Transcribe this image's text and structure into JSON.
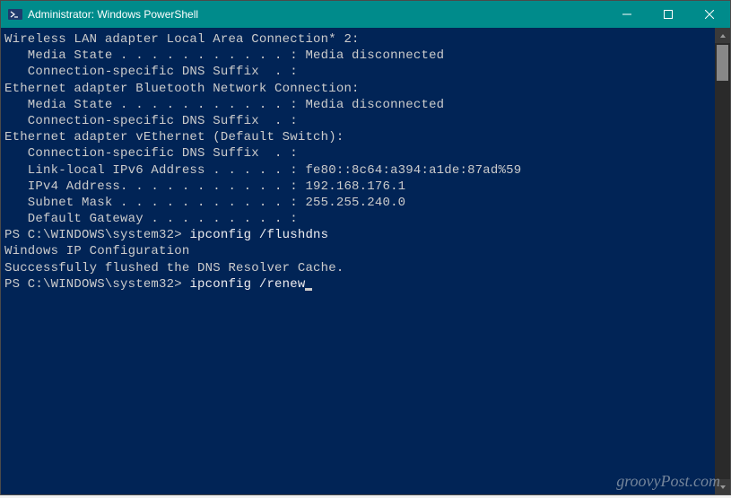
{
  "titlebar": {
    "title": "Administrator: Windows PowerShell"
  },
  "console": {
    "blank": "",
    "section1_header": "Wireless LAN adapter Local Area Connection* 2:",
    "section1_media": "   Media State . . . . . . . . . . . : Media disconnected",
    "section1_suffix": "   Connection-specific DNS Suffix  . :",
    "section2_header": "Ethernet adapter Bluetooth Network Connection:",
    "section2_media": "   Media State . . . . . . . . . . . : Media disconnected",
    "section2_suffix": "   Connection-specific DNS Suffix  . :",
    "section3_header": "Ethernet adapter vEthernet (Default Switch):",
    "section3_suffix": "   Connection-specific DNS Suffix  . :",
    "section3_ipv6": "   Link-local IPv6 Address . . . . . : fe80::8c64:a394:a1de:87ad%59",
    "section3_ipv4": "   IPv4 Address. . . . . . . . . . . : 192.168.176.1",
    "section3_mask": "   Subnet Mask . . . . . . . . . . . : 255.255.240.0",
    "section3_gw": "   Default Gateway . . . . . . . . . :",
    "prompt1_path": "PS C:\\WINDOWS\\system32> ",
    "prompt1_cmd": "ipconfig /flushdns",
    "ipconf_header": "Windows IP Configuration",
    "flush_success": "Successfully flushed the DNS Resolver Cache.",
    "prompt2_path": "PS C:\\WINDOWS\\system32> ",
    "prompt2_cmd": "ipconfig /renew"
  },
  "watermark": "groovyPost.com"
}
